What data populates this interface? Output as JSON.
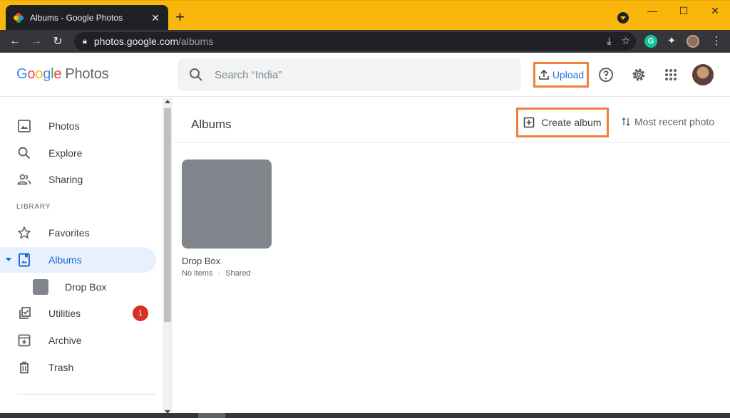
{
  "browser": {
    "tab_title": "Albums - Google Photos",
    "tab_close": "✕",
    "new_tab": "+",
    "url_host": "photos.google.com",
    "url_path": "/albums",
    "win_minimize": "—",
    "win_maximize": "☐",
    "win_close": "✕"
  },
  "header": {
    "logo_letters": [
      "G",
      "o",
      "o",
      "g",
      "l",
      "e"
    ],
    "logo_product": "Photos",
    "search_placeholder": "Search “India”",
    "upload_label": "Upload",
    "icons": [
      "search-icon",
      "upload-icon",
      "help-icon",
      "settings-icon",
      "apps-grid-icon",
      "avatar"
    ]
  },
  "sidebar": {
    "items": [
      {
        "label": "Photos",
        "icon": "photo-icon"
      },
      {
        "label": "Explore",
        "icon": "search-icon"
      },
      {
        "label": "Sharing",
        "icon": "people-icon"
      },
      {
        "label": "Favorites",
        "icon": "star-icon"
      },
      {
        "label": "Albums",
        "icon": "album-icon"
      },
      {
        "label": "Drop Box",
        "icon": "album-thumbnail"
      },
      {
        "label": "Utilities",
        "icon": "checklist-icon",
        "badge": "1"
      },
      {
        "label": "Archive",
        "icon": "archive-icon"
      },
      {
        "label": "Trash",
        "icon": "trash-icon"
      }
    ],
    "section_label": "LIBRARY",
    "active_item": "Albums"
  },
  "main": {
    "title": "Albums",
    "create_album_label": "Create album",
    "sort_label": "Most recent photo",
    "albums": [
      {
        "name": "Drop Box",
        "count": "No items",
        "separator": "·",
        "status": "Shared"
      }
    ]
  },
  "colors": {
    "accent": "#1a73e8",
    "highlight_border": "#f0803c",
    "titlebar": "#f9b60b",
    "badge": "#d93025",
    "active_bg": "#e8f0fe"
  }
}
